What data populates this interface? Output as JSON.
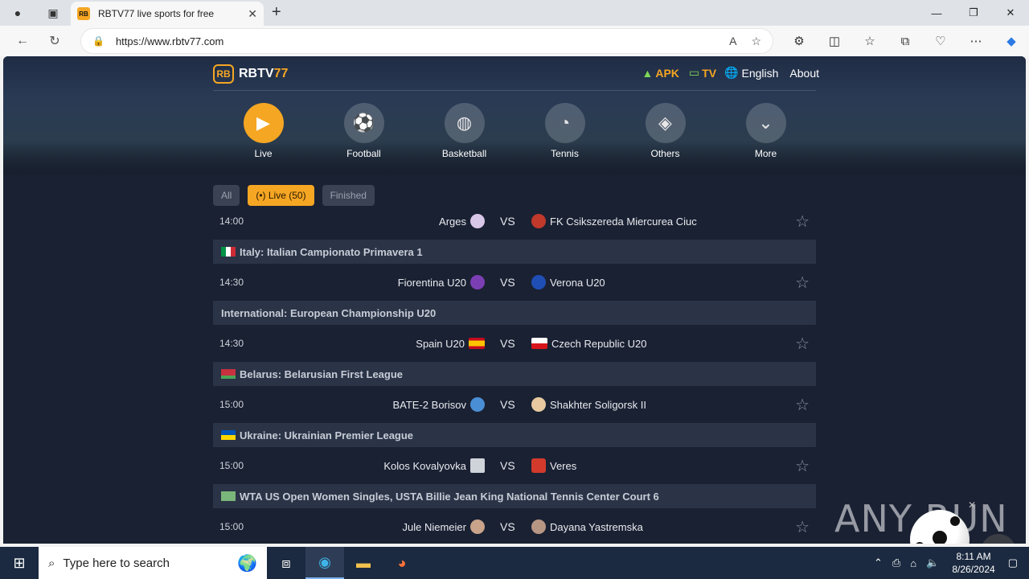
{
  "browser": {
    "tab_title": "RBTV77 live sports for free",
    "favicon_text": "RB",
    "url": "https://www.rbtv77.com"
  },
  "site": {
    "logo_mark": "RB",
    "brand_name": "RBTV",
    "brand_num": "77",
    "nav": {
      "apk": "APK",
      "tv": "TV",
      "language": "English",
      "about": "About"
    },
    "categories": [
      {
        "label": "Live",
        "icon": "live-tv-icon",
        "active": true
      },
      {
        "label": "Football",
        "icon": "football-icon",
        "active": false
      },
      {
        "label": "Basketball",
        "icon": "basketball-icon",
        "active": false
      },
      {
        "label": "Tennis",
        "icon": "tennis-icon",
        "active": false
      },
      {
        "label": "Others",
        "icon": "layers-icon",
        "active": false
      },
      {
        "label": "More",
        "icon": "chevron-down-icon",
        "active": false
      }
    ],
    "filters": {
      "all": "All",
      "live": "(•) Live (50)",
      "finished": "Finished"
    },
    "vs": "VS",
    "matches": {
      "m0": {
        "time": "14:00",
        "home": "Arges",
        "away": "FK Csikszereda Miercurea Ciuc"
      },
      "l1": "Italy: Italian Campionato Primavera 1",
      "m1": {
        "time": "14:30",
        "home": "Fiorentina U20",
        "away": "Verona U20"
      },
      "l2": "International: European Championship U20",
      "m2": {
        "time": "14:30",
        "home": "Spain U20",
        "away": "Czech Republic U20"
      },
      "l3": "Belarus: Belarusian First League",
      "m3": {
        "time": "15:00",
        "home": "BATE-2 Borisov",
        "away": "Shakhter Soligorsk II"
      },
      "l4": "Ukraine: Ukrainian Premier League",
      "m4": {
        "time": "15:00",
        "home": "Kolos Kovalyovka",
        "away": "Veres"
      },
      "l5": "WTA US Open Women Singles, USTA Billie Jean King National Tennis Center Court 6",
      "m5": {
        "time": "15:00",
        "home": "Jule Niemeier",
        "away": "Dayana Yastremska"
      }
    },
    "watermark": "ANY RUN"
  },
  "taskbar": {
    "search_placeholder": "Type here to search",
    "time": "8:11 AM",
    "date": "8/26/2024"
  }
}
